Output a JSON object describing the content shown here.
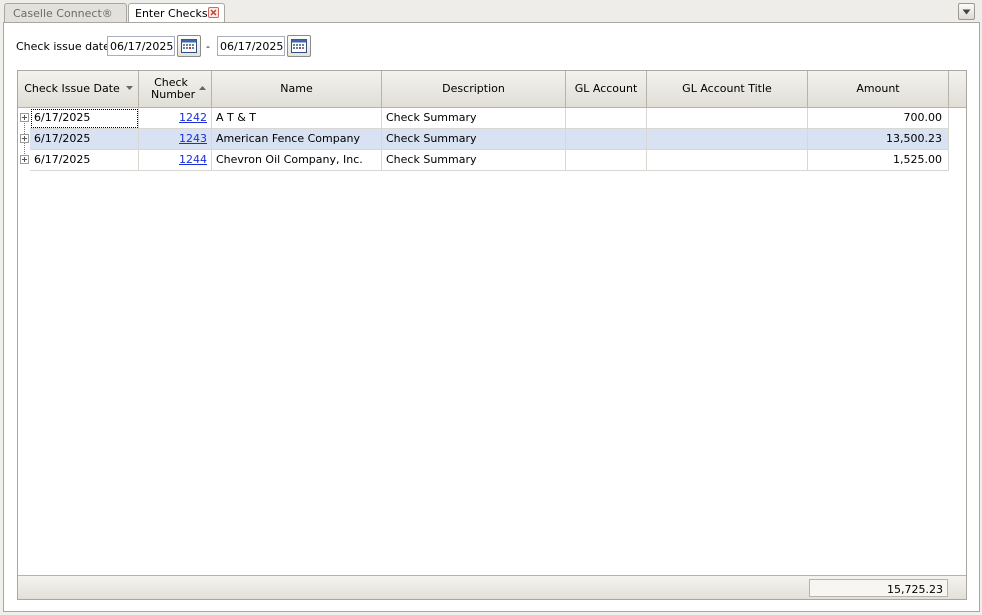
{
  "tabs": [
    {
      "label": "Caselle Connect®",
      "active": false
    },
    {
      "label": "Enter Checks",
      "active": true
    }
  ],
  "filter": {
    "label": "Check issue date:",
    "from_date": "06/17/2025",
    "separator": "-",
    "to_date": "06/17/2025"
  },
  "grid": {
    "columns": [
      "Check Issue Date",
      "Check Number",
      "Name",
      "Description",
      "GL Account",
      "GL Account Title",
      "Amount"
    ],
    "rows": [
      {
        "date": "6/17/2025",
        "check_number": "1242",
        "name": "A T & T",
        "description": "Check Summary",
        "gl_account": "",
        "gl_account_title": "",
        "amount": "700.00"
      },
      {
        "date": "6/17/2025",
        "check_number": "1243",
        "name": "American Fence Company",
        "description": "Check Summary",
        "gl_account": "",
        "gl_account_title": "",
        "amount": "13,500.23"
      },
      {
        "date": "6/17/2025",
        "check_number": "1244",
        "name": "Chevron Oil Company, Inc.",
        "description": "Check Summary",
        "gl_account": "",
        "gl_account_title": "",
        "amount": "1,525.00"
      }
    ],
    "total": "15,725.23"
  },
  "colors": {
    "selected_row": "#d8e2f3",
    "link": "#1b2fd8"
  }
}
